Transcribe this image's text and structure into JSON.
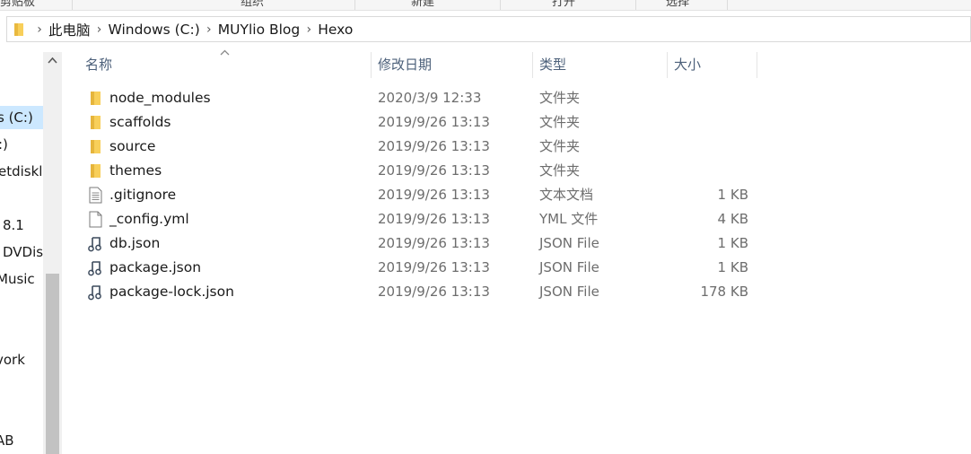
{
  "ribbon": {
    "labels": [
      "剪贴板",
      "组织",
      "新建",
      "打开",
      "选择"
    ]
  },
  "address": {
    "crumbs": [
      "此电脑",
      "Windows (C:)",
      "MUYlio Blog",
      "Hexo"
    ]
  },
  "nav": {
    "items": [
      {
        "label": "s (C:)",
        "selected": true
      },
      {
        "label": ":)"
      },
      {
        "label": "etdiskl"
      },
      {
        "label": ""
      },
      {
        "label": "8.1"
      },
      {
        "label": "DVDisc"
      },
      {
        "label": "Music"
      },
      {
        "label": "vork"
      },
      {
        "label": "AB"
      }
    ]
  },
  "columns": {
    "name": "名称",
    "date": "修改日期",
    "type": "类型",
    "size": "大小"
  },
  "files": [
    {
      "name": "node_modules",
      "date": "2020/3/9 12:33",
      "type": "文件夹",
      "size": "",
      "icon": "folder-icon"
    },
    {
      "name": "scaffolds",
      "date": "2019/9/26 13:13",
      "type": "文件夹",
      "size": "",
      "icon": "folder-icon"
    },
    {
      "name": "source",
      "date": "2019/9/26 13:13",
      "type": "文件夹",
      "size": "",
      "icon": "folder-icon"
    },
    {
      "name": "themes",
      "date": "2019/9/26 13:13",
      "type": "文件夹",
      "size": "",
      "icon": "folder-icon"
    },
    {
      "name": ".gitignore",
      "date": "2019/9/26 13:13",
      "type": "文本文档",
      "size": "1 KB",
      "icon": "text-document-icon"
    },
    {
      "name": "_config.yml",
      "date": "2019/9/26 13:13",
      "type": "YML 文件",
      "size": "4 KB",
      "icon": "blank-file-icon"
    },
    {
      "name": "db.json",
      "date": "2019/9/26 13:13",
      "type": "JSON File",
      "size": "1 KB",
      "icon": "json-file-icon"
    },
    {
      "name": "package.json",
      "date": "2019/9/26 13:13",
      "type": "JSON File",
      "size": "1 KB",
      "icon": "json-file-icon"
    },
    {
      "name": "package-lock.json",
      "date": "2019/9/26 13:13",
      "type": "JSON File",
      "size": "178 KB",
      "icon": "json-file-icon"
    }
  ],
  "colors": {
    "selection": "#cce8ff",
    "folder": "#f8cf5a",
    "header_text": "#4c607a"
  }
}
